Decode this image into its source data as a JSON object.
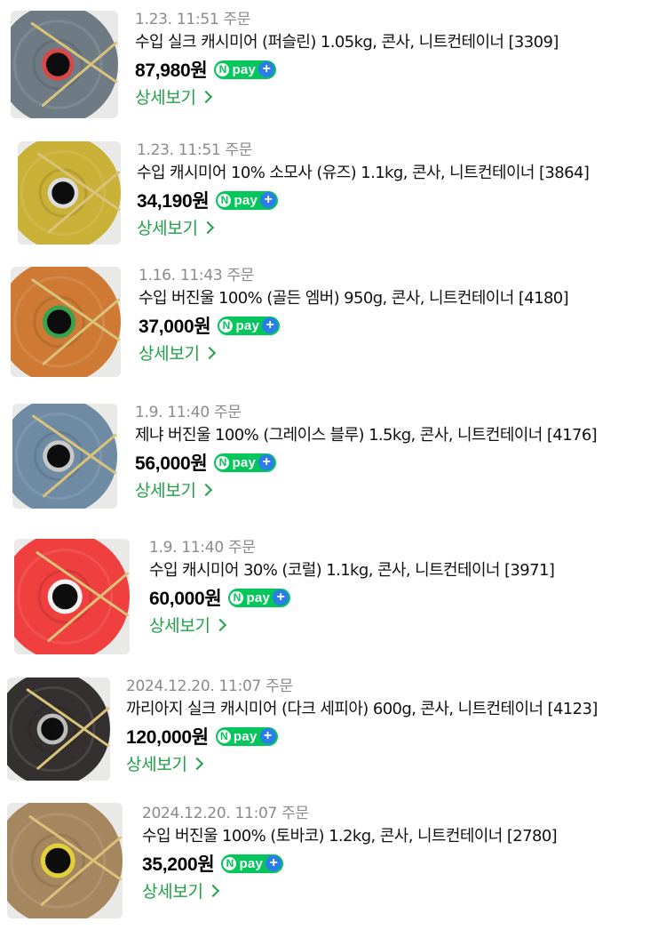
{
  "detail_label": "상세보기",
  "npay": {
    "n": "N",
    "text": "pay",
    "plus": "+"
  },
  "colors": {
    "npay_green": "#03c75a",
    "npay_plus_blue": "#2b7de9",
    "detail_link": "#20a246",
    "date_gray": "#8a8a8a"
  },
  "orders": [
    {
      "date": "1.23. 11:51 주문",
      "title": "수입 실크 캐시미어 (퍼슬린) 1.05kg, 콘사, 니트컨테이너 [3309]",
      "price": "87,980원",
      "yarn_color": "#6f7b84",
      "core_color": "#d94848"
    },
    {
      "date": "1.23. 11:51 주문",
      "title": "수입 캐시미어 10% 소모사 (유즈) 1.1kg, 콘사, 니트컨테이너 [3864]",
      "price": "34,190원",
      "yarn_color": "#c9b036",
      "core_color": "#dcdcdc"
    },
    {
      "date": "1.16. 11:43 주문",
      "title": "수입 버진울 100% (골든 엠버) 950g, 콘사, 니트컨테이너 [4180]",
      "price": "37,000원",
      "yarn_color": "#cf7a34",
      "core_color": "#3aa14c"
    },
    {
      "date": "1.9. 11:40 주문",
      "title": "제냐 버진울 100% (그레이스 블루) 1.5kg, 콘사, 니트컨테이너 [4176]",
      "price": "56,000원",
      "yarn_color": "#6f8ba4",
      "core_color": "#c8c8c8"
    },
    {
      "date": "1.9. 11:40 주문",
      "title": "수입 캐시미어 30% (코럴) 1.1kg, 콘사, 니트컨테이너 [3971]",
      "price": "60,000원",
      "yarn_color": "#ef3f3f",
      "core_color": "#f2f2f2"
    },
    {
      "date": "2024.12.20. 11:07 주문",
      "title": "까리아지 실크 캐시미어 (다크 세피아) 600g, 콘사, 니트컨테이너 [4123]",
      "price": "120,000원",
      "yarn_color": "#34302f",
      "core_color": "#bdbdbd"
    },
    {
      "date": "2024.12.20. 11:07 주문",
      "title": "수입 버진울 100% (토바코) 1.2kg, 콘사, 니트컨테이너 [2780]",
      "price": "35,200원",
      "yarn_color": "#a4875f",
      "core_color": "#e2cf39"
    }
  ]
}
